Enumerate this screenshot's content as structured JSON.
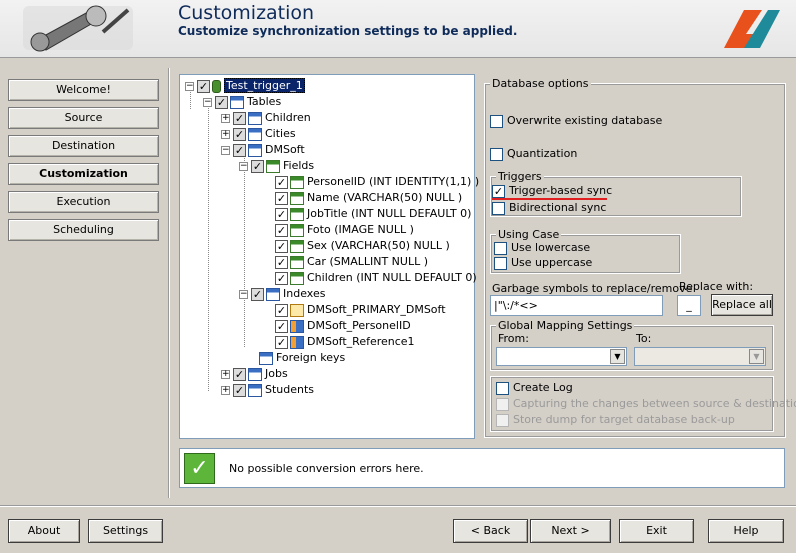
{
  "header": {
    "title": "Customization",
    "subtitle": "Customize synchronization settings to be applied."
  },
  "nav": [
    {
      "label": "Welcome!"
    },
    {
      "label": "Source"
    },
    {
      "label": "Destination"
    },
    {
      "label": "Customization",
      "active": true
    },
    {
      "label": "Execution"
    },
    {
      "label": "Scheduling"
    }
  ],
  "tree": {
    "root": "Test_trigger_1",
    "tables_label": "Tables",
    "children_label": "Children",
    "cities_label": "Cities",
    "dmsoft_label": "DMSoft",
    "fields_label": "Fields",
    "fields": [
      "PersonelID (INT IDENTITY(1,1) )",
      "Name (VARCHAR(50) NULL )",
      "JobTitle (INT NULL  DEFAULT 0)",
      "Foto (IMAGE NULL )",
      "Sex (VARCHAR(50) NULL )",
      "Car (SMALLINT NULL )",
      "Children (INT NULL  DEFAULT 0)"
    ],
    "indexes_label": "Indexes",
    "indexes": [
      "DMSoft_PRIMARY_DMSoft",
      "DMSoft_PersonelID",
      "DMSoft_Reference1"
    ],
    "foreign_keys_label": "Foreign keys",
    "jobs_label": "Jobs",
    "students_label": "Students"
  },
  "options": {
    "db_group": "Database options",
    "overwrite": "Overwrite existing database",
    "quantization": "Quantization",
    "triggers_group": "Triggers",
    "trigger_sync": "Trigger-based sync",
    "bidirectional": "Bidirectional sync",
    "case_group": "Using Case",
    "lowercase": "Use lowercase",
    "uppercase": "Use uppercase",
    "garbage_label": "Garbage symbols to replace/remove",
    "garbage_value": "|\"\\:/*<>",
    "replace_with_label": "Replace with:",
    "replace_with_value": "_",
    "replace_all": "Replace all",
    "mapping_group": "Global Mapping Settings",
    "from_label": "From:",
    "to_label": "To:",
    "create_log": "Create Log",
    "capturing": "Capturing the changes between source & destinatio",
    "store_dump": "Store dump for target database back-up"
  },
  "status": {
    "message": "No possible conversion errors here."
  },
  "buttons": {
    "about": "About",
    "settings": "Settings",
    "back": "< Back",
    "next": "Next >",
    "exit": "Exit",
    "help": "Help"
  },
  "colors": {
    "accent_underline": "#e02020",
    "header_text": "#0f2b5a",
    "selection": "#0a246a"
  }
}
